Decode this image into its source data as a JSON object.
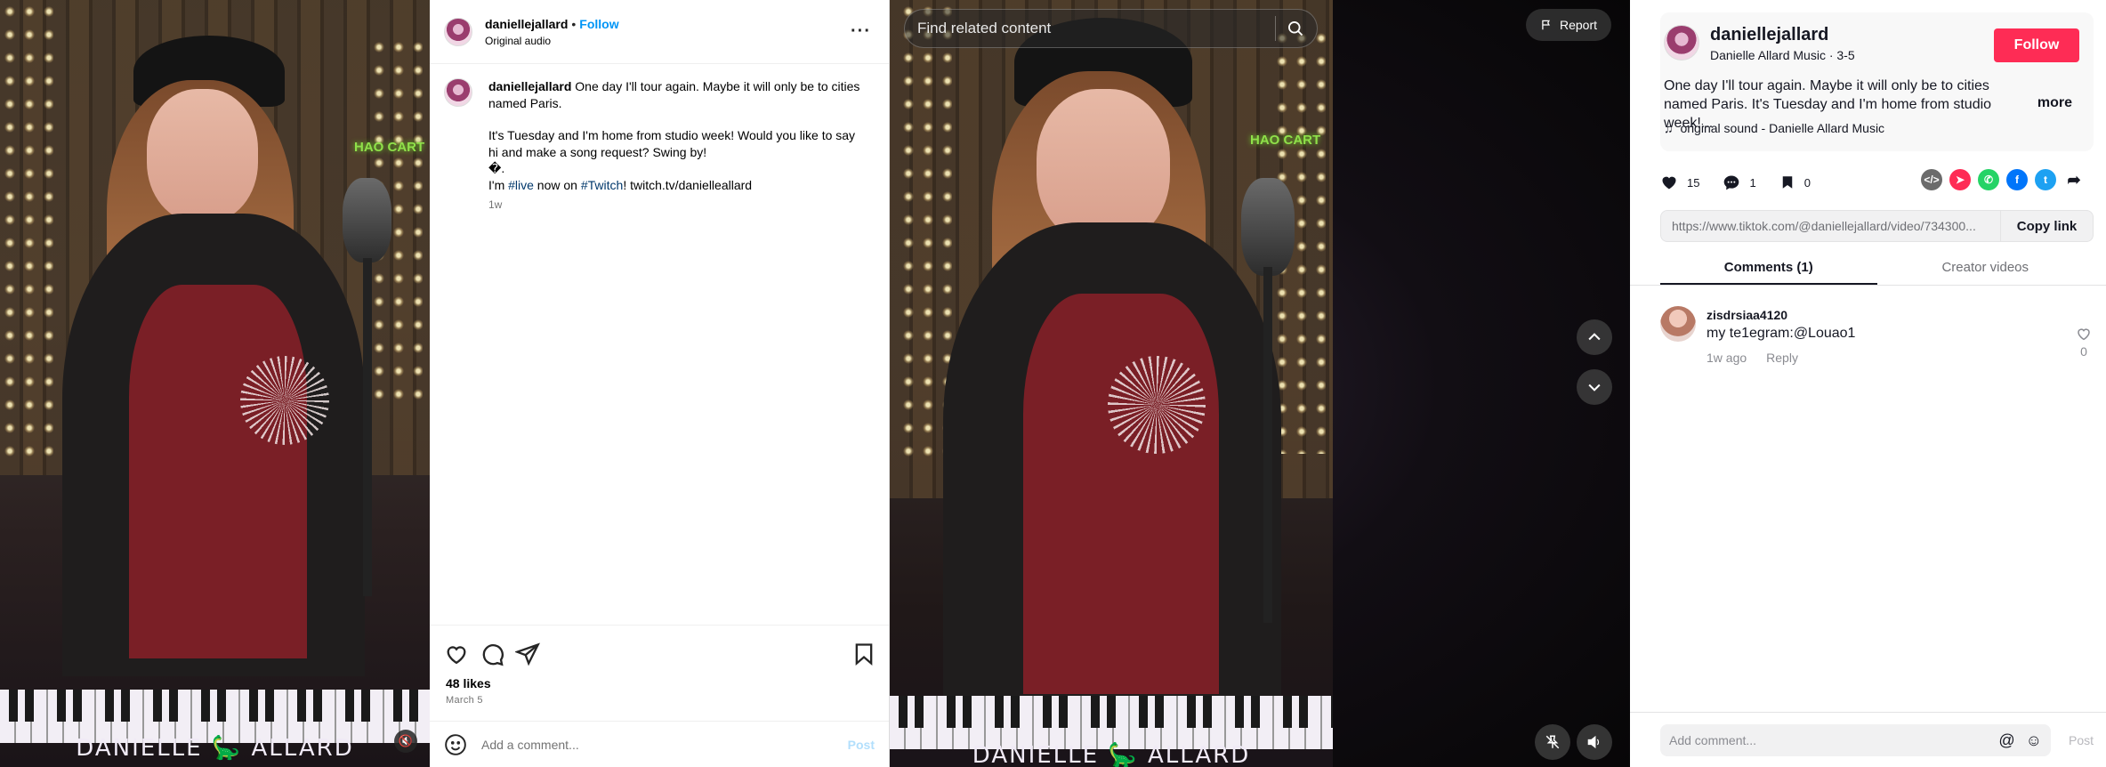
{
  "instagram": {
    "video": {
      "banner_left": "DANIELLE",
      "banner_right": "ALLARD",
      "neon_text": "HAO CART"
    },
    "header": {
      "username": "daniellejallard",
      "separator": "•",
      "follow_label": "Follow",
      "audio": "Original audio",
      "more": "···"
    },
    "caption": {
      "username": "daniellejallard",
      "line1": "One day I'll tour again. Maybe it will only be to cities named Paris.",
      "para2": "It's Tuesday and I'm home from studio week! Would you like to say hi and make a song request? Swing by!",
      "glyph": "�.",
      "p3_prefix": "I'm ",
      "tag_live": "#live",
      "p3_mid": " now on ",
      "tag_twitch": "#Twitch",
      "p3_suffix": "! twitch.tv/danielleallard",
      "time": "1w"
    },
    "likes": "48 likes",
    "date": "March 5",
    "comment_placeholder": "Add a comment...",
    "post_label": "Post"
  },
  "tiktok": {
    "search_placeholder": "Find related content",
    "report_label": "Report",
    "video": {
      "banner_left": "DANIELLE",
      "banner_right": "ALLARD",
      "neon_text": "HAO CART"
    },
    "author": {
      "username": "daniellejallard",
      "sub": "Danielle Allard Music · 3-5",
      "follow_label": "Follow",
      "description": "One day I'll tour again. Maybe it will only be to cities named Paris. It's Tuesday and I'm home from studio week!...",
      "more_label": "more",
      "sound": "original sound - Danielle Allard Music"
    },
    "stats": {
      "likes": "15",
      "comments": "1",
      "saves": "0"
    },
    "share_icons": [
      "embed-icon",
      "friends-icon",
      "whatsapp-icon",
      "facebook-icon",
      "twitter-icon",
      "share-icon"
    ],
    "link": {
      "url": "https://www.tiktok.com/@daniellejallard/video/734300...",
      "copy_label": "Copy link"
    },
    "tabs": [
      "Comments (1)",
      "Creator videos"
    ],
    "comment": {
      "user": "zisdrsiaa4120",
      "text": "my te1egram:@Louao1",
      "time": "1w ago",
      "reply": "Reply",
      "likes": "0"
    },
    "add_comment_placeholder": "Add comment...",
    "post_label": "Post",
    "colors": {
      "brand": "#fe2c55"
    }
  }
}
